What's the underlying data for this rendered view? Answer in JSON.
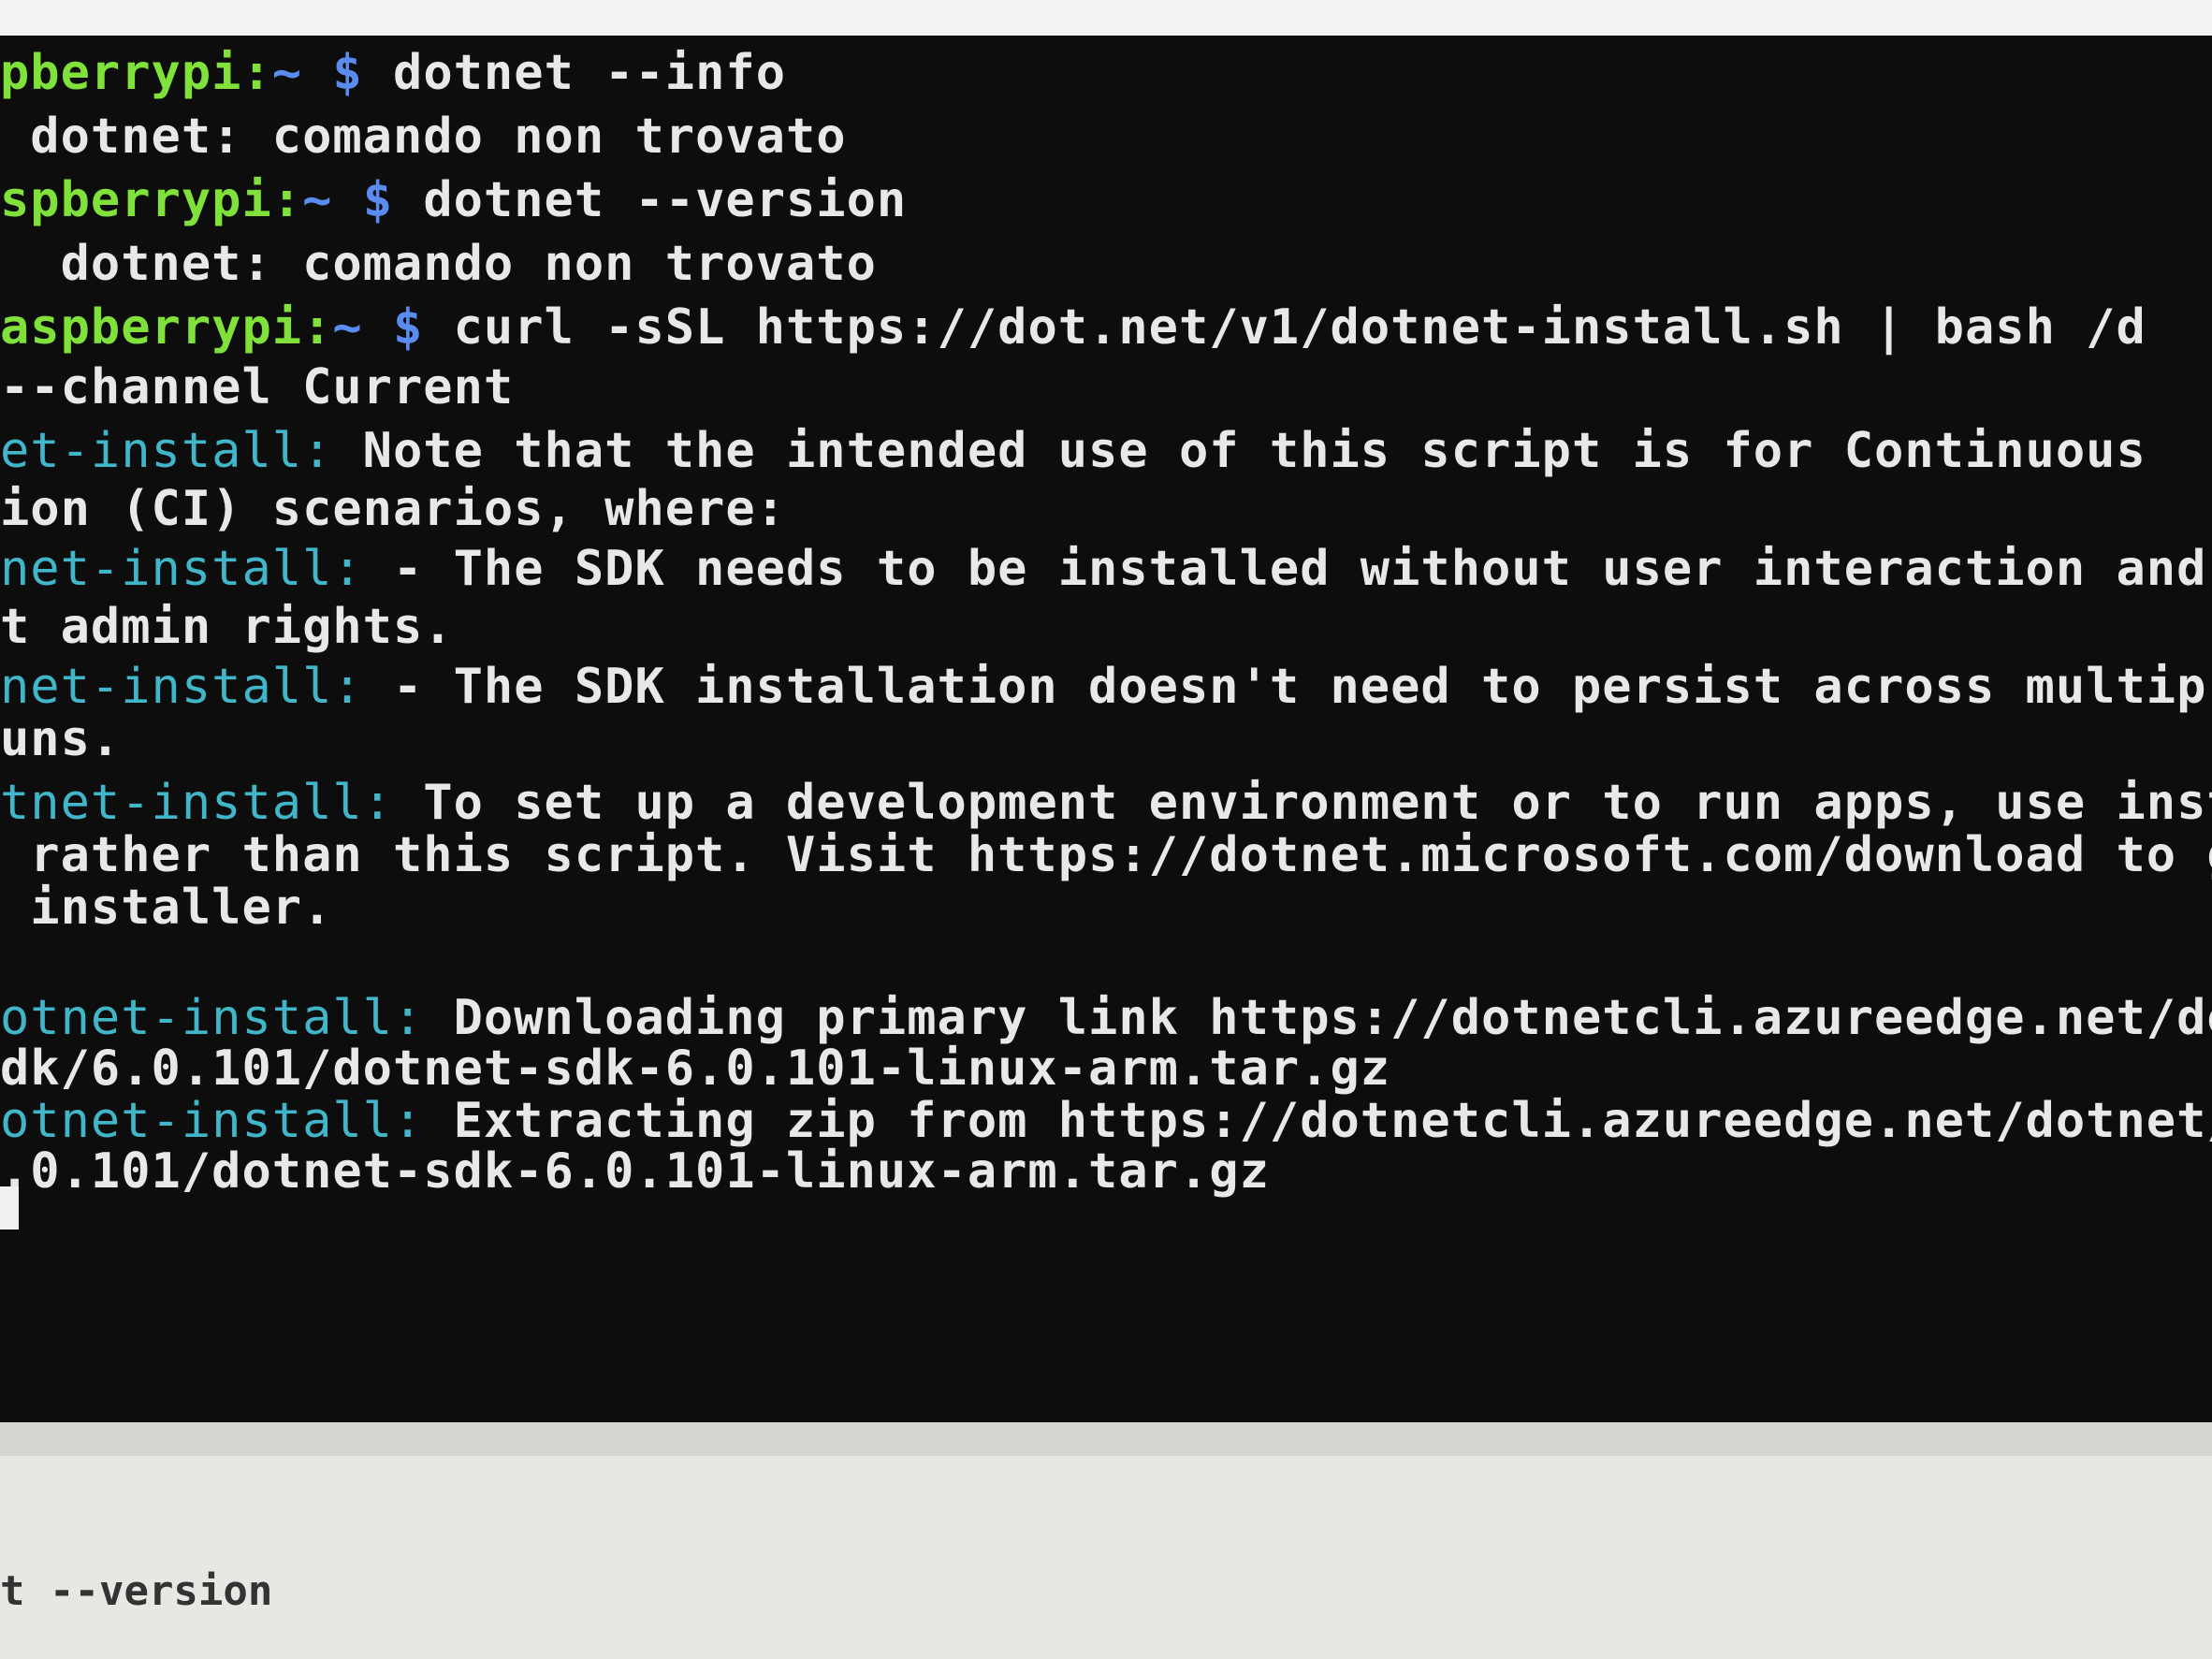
{
  "terminal": {
    "lines": [
      {
        "prefix": "pberrypi:",
        "tilde": "~",
        "dollar": "$",
        "text": " dotnet --info"
      },
      {
        "text": " dotnet: comando non trovato"
      },
      {
        "prefix": "spberrypi:",
        "tilde": "~",
        "dollar": "$",
        "text": " dotnet --version"
      },
      {
        "text": "  dotnet: comando non trovato"
      },
      {
        "prefix": "aspberrypi:",
        "tilde": "~",
        "dollar": "$",
        "text": " curl -sSL https://dot.net/v1/dotnet-install.sh | bash /d"
      },
      {
        "text": "--channel Current"
      },
      {
        "tag": "et-install:",
        "text": " Note that the intended use of this script is for Continuous"
      },
      {
        "text": "ion (CI) scenarios, where:"
      },
      {
        "tag": "net-install:",
        "text": " - The SDK needs to be installed without user interaction and"
      },
      {
        "text": "t admin rights."
      },
      {
        "tag": "net-install:",
        "text": " - The SDK installation doesn't need to persist across multip"
      },
      {
        "text": "uns."
      },
      {
        "tag": "tnet-install:",
        "text": " To set up a development environment or to run apps, use insta"
      },
      {
        "text": " rather than this script. Visit https://dotnet.microsoft.com/download to ge"
      },
      {
        "text": " installer."
      },
      {
        "text": ""
      },
      {
        "tag": "otnet-install:",
        "text": " Downloading primary link https://dotnetcli.azureedge.net/dotne"
      },
      {
        "text": "dk/6.0.101/dotnet-sdk-6.0.101-linux-arm.tar.gz"
      },
      {
        "tag": "otnet-install:",
        "text": " Extracting zip from https://dotnetcli.azureedge.net/dotnet/Sdk/"
      },
      {
        "text": ".0.101/dotnet-sdk-6.0.101-linux-arm.tar.gz"
      }
    ]
  },
  "bottom": {
    "text": "t --version"
  }
}
